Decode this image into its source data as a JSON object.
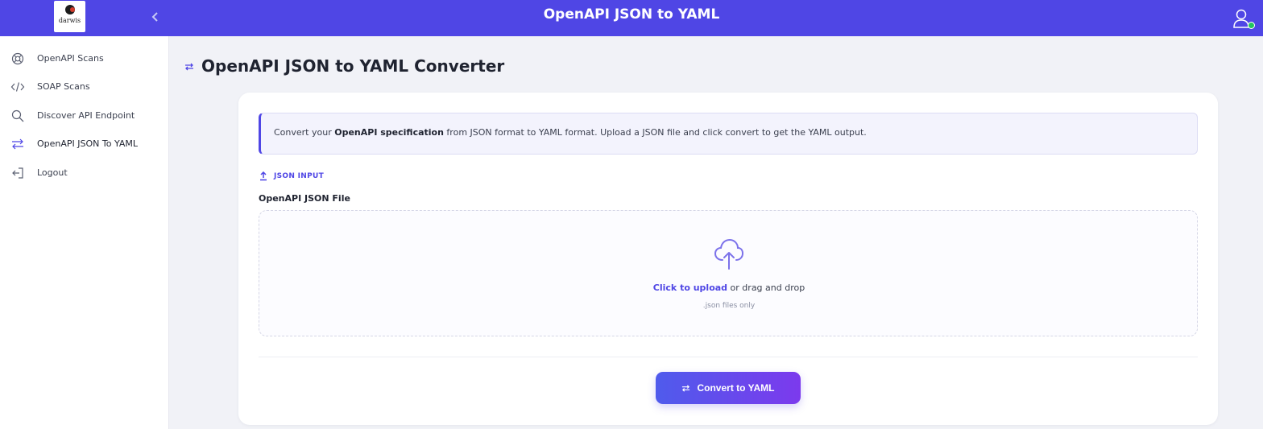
{
  "header": {
    "logo_text": "darwis",
    "title": "OpenAPI JSON to YAML",
    "collapse_icon": "chevron-left-icon",
    "user_icon": "user-icon",
    "online_color": "#22c55e"
  },
  "sidebar": {
    "items": [
      {
        "label": "OpenAPI Scans",
        "icon": "lifebuoy-icon"
      },
      {
        "label": "SOAP Scans",
        "icon": "code-icon"
      },
      {
        "label": "Discover API Endpoint",
        "icon": "search-icon"
      },
      {
        "label": "OpenAPI JSON To YAML",
        "icon": "swap-icon",
        "active": true
      },
      {
        "label": "Logout",
        "icon": "logout-icon"
      }
    ]
  },
  "main": {
    "title": "OpenAPI JSON to YAML Converter",
    "info": {
      "prefix": "Convert your ",
      "bold": "OpenAPI specification",
      "suffix": " from JSON format to YAML format. Upload a JSON file and click convert to get the YAML output."
    },
    "section_label": "JSON INPUT",
    "field_label": "OpenAPI JSON File",
    "upload": {
      "link": "Click to upload",
      "rest": " or drag and drop",
      "hint": ".json files only"
    },
    "convert_label": "Convert to YAML"
  },
  "colors": {
    "accent": "#4f46e5",
    "button_gradient_end": "#7c3aed"
  }
}
